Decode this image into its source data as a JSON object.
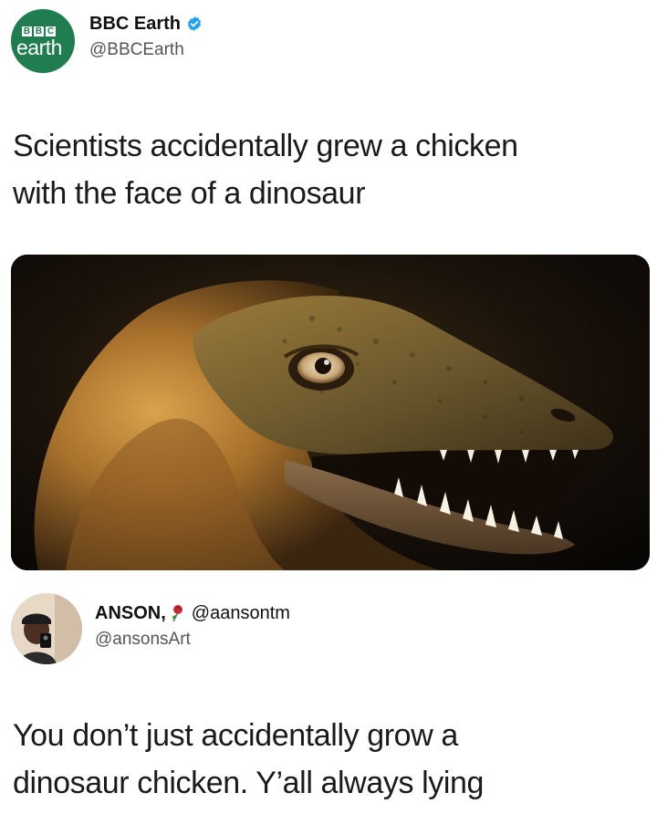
{
  "tweet": {
    "logo_blocks": [
      "B",
      "B",
      "C"
    ],
    "logo_word": "earth",
    "author_name": "BBC Earth",
    "author_handle": "@BBCEarth",
    "verified": true,
    "text_line1": "Scientists accidentally grew a chicken",
    "text_line2": "with the face of a dinosaur",
    "brand_color": "#1f7d4f",
    "verified_color": "#1da1f2"
  },
  "reply": {
    "author_name": "ANSON,",
    "name_suffix": "@aansontm",
    "author_handle": "@ansonsArt",
    "text_line1": "You don’t just accidentally grow a",
    "text_line2": "dinosaur chicken. Y’all always lying"
  },
  "icons": {
    "verified": "verified-badge-icon",
    "name_emoji": "rose-icon"
  }
}
